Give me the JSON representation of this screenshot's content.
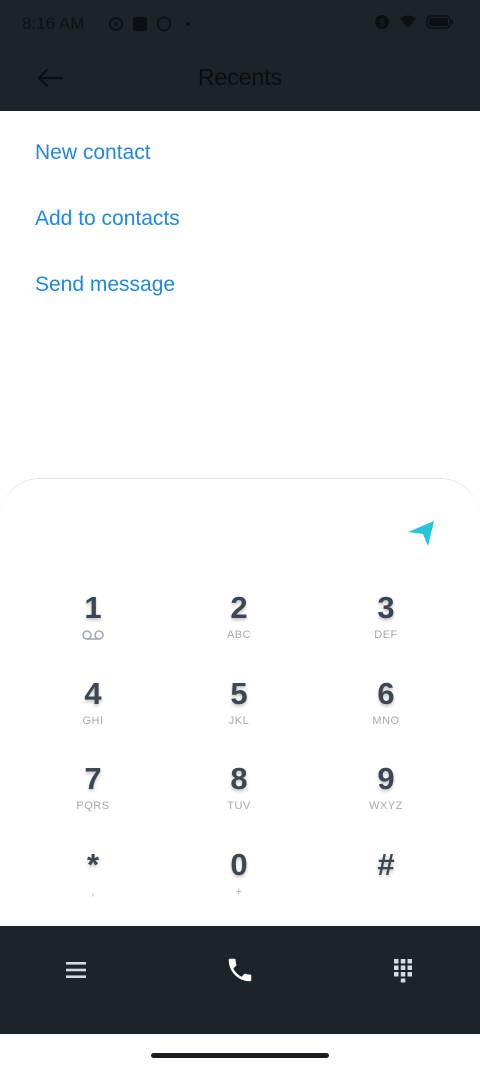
{
  "status_bar": {
    "time": "8:16 AM"
  },
  "app_bar": {
    "title": "Recents"
  },
  "menu": {
    "items": [
      {
        "label": "New contact"
      },
      {
        "label": "Add to contacts"
      },
      {
        "label": "Send message"
      }
    ]
  },
  "dialpad": {
    "keys": [
      {
        "digit": "1",
        "letters": ""
      },
      {
        "digit": "2",
        "letters": "ABC"
      },
      {
        "digit": "3",
        "letters": "DEF"
      },
      {
        "digit": "4",
        "letters": "GHI"
      },
      {
        "digit": "5",
        "letters": "JKL"
      },
      {
        "digit": "6",
        "letters": "MNO"
      },
      {
        "digit": "7",
        "letters": "PQRS"
      },
      {
        "digit": "8",
        "letters": "TUV"
      },
      {
        "digit": "9",
        "letters": "WXYZ"
      },
      {
        "digit": "*",
        "letters": ","
      },
      {
        "digit": "0",
        "letters": "+"
      },
      {
        "digit": "#",
        "letters": ""
      }
    ]
  },
  "icons": {
    "back": "back-arrow-icon",
    "send": "send-icon",
    "voicemail": "voicemail-icon",
    "menu": "menu-icon",
    "call": "phone-icon",
    "dialpad": "dialpad-icon"
  },
  "colors": {
    "bar_background": "#1e2229",
    "accent_link": "#1e88e5",
    "send_accent": "#26c6da",
    "digit": "#3d4651"
  }
}
